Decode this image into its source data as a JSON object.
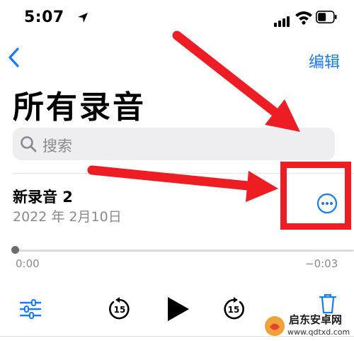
{
  "status_bar": {
    "time": "5:07"
  },
  "nav": {
    "back_label": "",
    "edit_label": "编辑"
  },
  "page_title": "所有录音",
  "search": {
    "placeholder": "搜索"
  },
  "recording": {
    "name": "新录音 2",
    "date": "2022 年 2月10日",
    "elapsed": "0:00",
    "remaining": "−0:03",
    "progress": 0
  },
  "playback_controls": {
    "skip_back_seconds": "15",
    "skip_forward_seconds": "15"
  },
  "watermark": {
    "brand": "启东安卓网",
    "url": "www.qdtxd.com"
  },
  "colors": {
    "accent": "#1a7cf5",
    "annotation": "#ee1d24"
  }
}
